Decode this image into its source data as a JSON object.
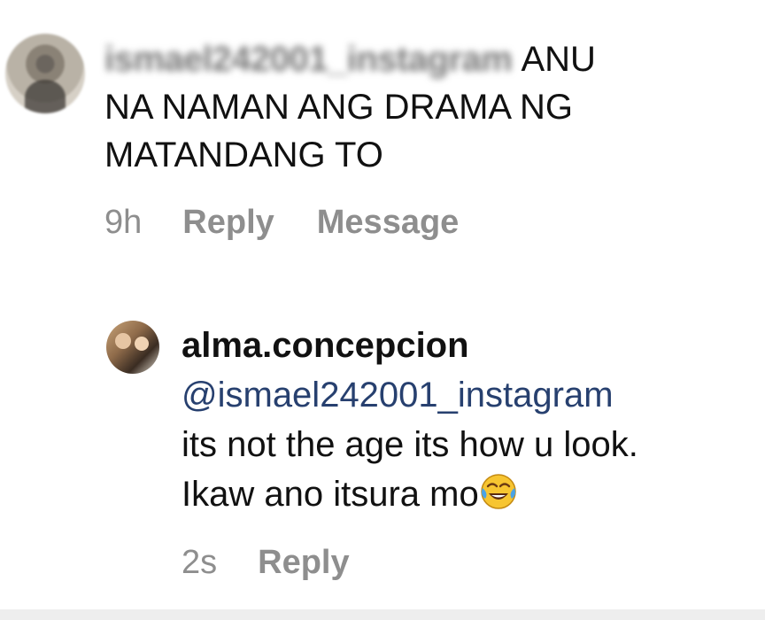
{
  "comments": [
    {
      "avatar_icon": "avatar-blurred",
      "username": "ismael242001_instagram",
      "text_line1": "ANU",
      "text_line2": "NA NAMAN ANG DRAMA NG",
      "text_line3": "MATANDANG TO",
      "time": "9h",
      "reply_label": "Reply",
      "message_label": "Message"
    },
    {
      "avatar_icon": "avatar-photo",
      "username": "alma.concepcion",
      "mention": "@ismael242001_instagram",
      "text_line1": "its not the age its how u look.",
      "text_line2": "Ikaw ano itsura mo",
      "emoji": "face-with-tears-of-joy",
      "time": "2s",
      "reply_label": "Reply"
    }
  ],
  "colors": {
    "text": "#111111",
    "mention": "#27406f",
    "meta": "#8e8e8e",
    "background": "#ffffff"
  }
}
